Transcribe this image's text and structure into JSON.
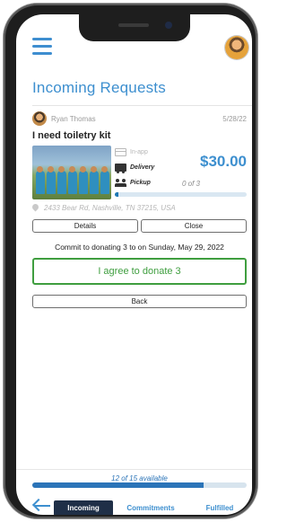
{
  "header": {
    "title": "Incoming Requests",
    "menu_icon": "hamburger-menu-icon",
    "profile_icon": "user-avatar-icon"
  },
  "request": {
    "author": "Ryan Thomas",
    "date": "5/28/22",
    "title": "I need toiletry kit",
    "methods": {
      "in_app": "In-app",
      "delivery": "Delivery",
      "pickup": "Pickup"
    },
    "price": "$30.00",
    "progress_text": "0 of 3",
    "progress_fraction": 0.03,
    "address": "2433 Bear Rd, Nashville, TN 37215, USA",
    "buttons": {
      "details": "Details",
      "close": "Close"
    }
  },
  "commitment": {
    "message": "Commit to donating 3 to on Sunday, May 29, 2022",
    "agree_label": "I agree to donate 3",
    "back_label": "Back"
  },
  "footer": {
    "available_text": "12 of 15 available",
    "available_fraction": 0.8,
    "tabs": [
      {
        "label": "Incoming",
        "active": true
      },
      {
        "label": "Commitments",
        "active": false
      },
      {
        "label": "Fulfilled",
        "active": false
      }
    ]
  },
  "colors": {
    "accent": "#3d8fcf",
    "agree_green": "#3f9e3f",
    "active_tab_bg": "#1f2f47"
  }
}
